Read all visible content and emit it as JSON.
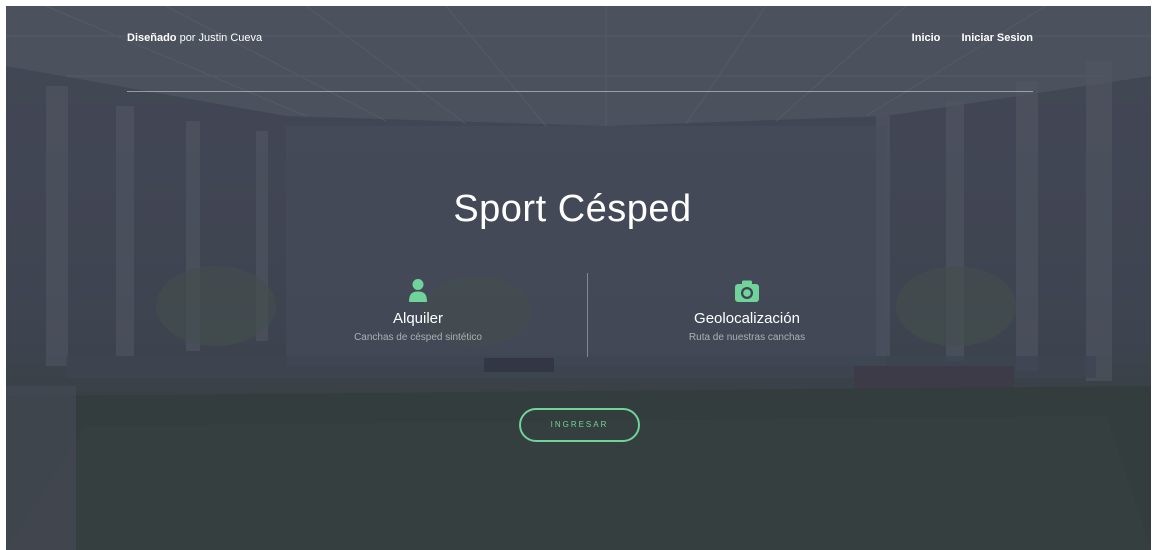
{
  "header": {
    "brand_bold": "Diseñado",
    "brand_rest": " por Justin Cueva",
    "nav": [
      "Inicio",
      "Iniciar Sesion"
    ]
  },
  "hero": {
    "title": "Sport Césped"
  },
  "features": [
    {
      "icon": "user-icon",
      "title": "Alquiler",
      "subtitle": "Canchas de césped sintético"
    },
    {
      "icon": "camera-icon",
      "title": "Geolocalización",
      "subtitle": "Ruta de nuestras canchas"
    }
  ],
  "cta": {
    "label": "INGRESAR"
  },
  "colors": {
    "accent": "#6fd39a",
    "overlay": "#3c404e"
  }
}
